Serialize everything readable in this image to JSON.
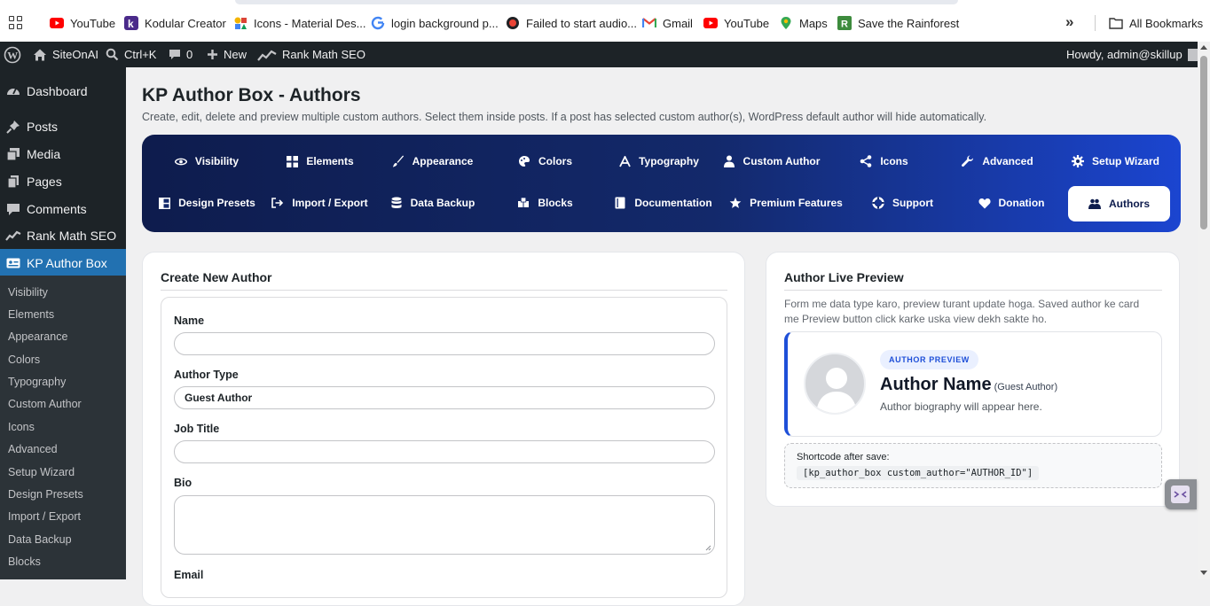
{
  "browser": {
    "bookmarks": [
      {
        "label": "YouTube",
        "icon": "youtube-icon"
      },
      {
        "label": "Kodular Creator",
        "icon": "kodular-icon"
      },
      {
        "label": "Icons - Material Des...",
        "icon": "material-icon"
      },
      {
        "label": "login background p...",
        "icon": "google-icon"
      },
      {
        "label": "Failed to start audio...",
        "icon": "record-icon"
      },
      {
        "label": "Gmail",
        "icon": "gmail-icon"
      },
      {
        "label": "YouTube",
        "icon": "youtube-icon"
      },
      {
        "label": "Maps",
        "icon": "maps-icon"
      },
      {
        "label": "Save the Rainforest",
        "icon": "rainforest-icon"
      }
    ],
    "more": "»",
    "all_bookmarks": "All Bookmarks"
  },
  "adminbar": {
    "site": "SiteOnAI",
    "search": "Ctrl+K",
    "comments_count": "0",
    "new": "New",
    "rankmath": "Rank Math SEO",
    "howdy": "Howdy, admin@skillup"
  },
  "sidebar": {
    "menu": [
      {
        "label": "Dashboard",
        "icon": "dashboard-icon"
      },
      {
        "label": "Posts",
        "icon": "pin-icon"
      },
      {
        "label": "Media",
        "icon": "media-icon"
      },
      {
        "label": "Pages",
        "icon": "pages-icon"
      },
      {
        "label": "Comments",
        "icon": "comments-icon"
      },
      {
        "label": "Rank Math SEO",
        "icon": "rankmath-icon"
      },
      {
        "label": "KP Author Box",
        "icon": "idcard-icon"
      }
    ],
    "submenu": [
      "Visibility",
      "Elements",
      "Appearance",
      "Colors",
      "Typography",
      "Custom Author",
      "Icons",
      "Advanced",
      "Setup Wizard",
      "Design Presets",
      "Import / Export",
      "Data Backup",
      "Blocks"
    ]
  },
  "page": {
    "title": "KP Author Box - Authors",
    "description": "Create, edit, delete and preview multiple custom authors. Select them inside posts. If a post has selected custom author(s), WordPress default author will hide automatically."
  },
  "nav": {
    "row1": [
      {
        "label": "Visibility",
        "icon": "eye-icon"
      },
      {
        "label": "Elements",
        "icon": "grid-icon"
      },
      {
        "label": "Appearance",
        "icon": "brush-icon"
      },
      {
        "label": "Colors",
        "icon": "palette-icon"
      },
      {
        "label": "Typography",
        "icon": "font-icon"
      },
      {
        "label": "Custom Author",
        "icon": "user-icon"
      },
      {
        "label": "Icons",
        "icon": "share-icon"
      },
      {
        "label": "Advanced",
        "icon": "wrench-icon"
      },
      {
        "label": "Setup Wizard",
        "icon": "gear-icon"
      }
    ],
    "row2": [
      {
        "label": "Design Presets",
        "icon": "layout-icon"
      },
      {
        "label": "Import / Export",
        "icon": "sign-out-icon"
      },
      {
        "label": "Data Backup",
        "icon": "database-icon"
      },
      {
        "label": "Blocks",
        "icon": "cubes-icon"
      },
      {
        "label": "Documentation",
        "icon": "book-icon"
      },
      {
        "label": "Premium Features",
        "icon": "star-icon"
      },
      {
        "label": "Support",
        "icon": "lifebuoy-icon"
      },
      {
        "label": "Donation",
        "icon": "heart-icon"
      },
      {
        "label": "Authors",
        "icon": "users-icon",
        "active": true
      }
    ]
  },
  "create": {
    "title": "Create New Author",
    "name_label": "Name",
    "name_value": "",
    "type_label": "Author Type",
    "type_value": "Guest Author",
    "job_label": "Job Title",
    "job_value": "",
    "bio_label": "Bio",
    "email_label": "Email"
  },
  "preview": {
    "title": "Author Live Preview",
    "description": "Form me data type karo, preview turant update hoga. Saved author ke card me Preview button click karke uska view dekh sakte ho.",
    "badge": "AUTHOR PREVIEW",
    "name": "Author Name",
    "type": "(Guest Author)",
    "bio": "Author biography will appear here.",
    "shortcode_label": "Shortcode after save:",
    "shortcode": "[kp_author_box custom_author=\"AUTHOR_ID\"]"
  },
  "colors": {
    "wp_dark": "#1d2327",
    "wp_blue": "#2271b1",
    "nav_start": "#0e1c4d",
    "nav_end": "#1b45d0",
    "accent": "#1e4fd8"
  }
}
